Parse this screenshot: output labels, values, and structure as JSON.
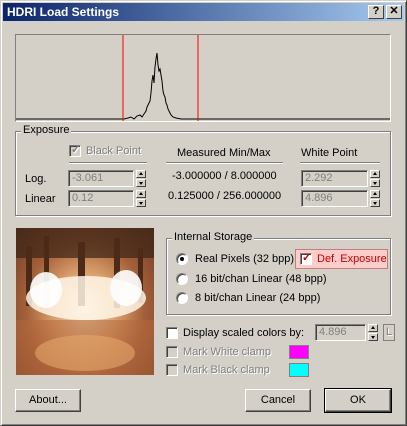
{
  "window": {
    "title": "HDRI Load Settings",
    "help_label": "?",
    "close_label": "✕"
  },
  "histogram": {
    "line_color": "#000000",
    "marker_color": "#ff0000"
  },
  "exposure": {
    "group_label": "Exposure",
    "black_point_label": "Black Point",
    "black_point_checked": true,
    "measured_header": "Measured Min/Max",
    "white_point_header": "White Point",
    "log_label": "Log.",
    "linear_label": "Linear",
    "log_black": "-3.061",
    "linear_black": "0.12",
    "log_measured": "-3.000000 / 8.000000",
    "linear_measured": "0.125000 / 256.000000",
    "log_white": "2.292",
    "linear_white": "4.896"
  },
  "storage": {
    "group_label": "Internal Storage",
    "options": [
      {
        "label": "Real Pixels (32 bpp)",
        "selected": true
      },
      {
        "label": "16 bit/chan Linear (48 bpp)",
        "selected": false
      },
      {
        "label": "8 bit/chan Linear (24 bpp)",
        "selected": false
      }
    ],
    "def_exposure_label": "Def. Exposure",
    "def_exposure_checked": true,
    "def_exposure_bg": "#ffcccc"
  },
  "display": {
    "scaled_label": "Display scaled colors by:",
    "scaled_value": "4.896",
    "scaled_checked": false,
    "lock_label": "L",
    "white_clamp_label": "Mark White clamp",
    "white_clamp_color": "#ff00ff",
    "black_clamp_label": "Mark Black clamp",
    "black_clamp_color": "#00ffff"
  },
  "buttons": {
    "about": "About...",
    "cancel": "Cancel",
    "ok": "OK"
  }
}
